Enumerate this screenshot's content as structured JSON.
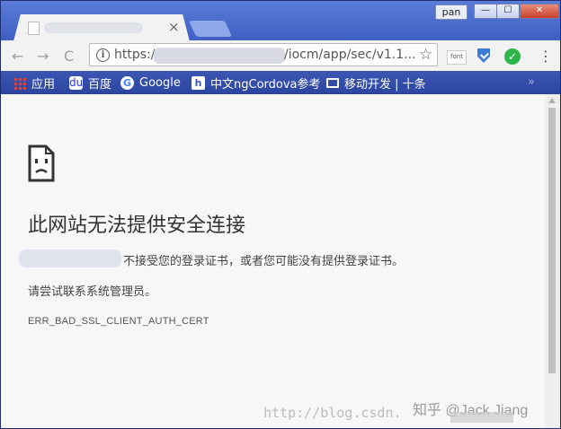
{
  "window": {
    "profile_name": "pan",
    "minimize_glyph": "—",
    "maximize_glyph": "☐",
    "close_glyph": "✕"
  },
  "tab": {
    "close_glyph": "×"
  },
  "toolbar": {
    "back_glyph": "←",
    "forward_glyph": "→",
    "reload_glyph": "C",
    "url_scheme": "https://",
    "url_tail": "/iocm/app/sec/v1.1...",
    "info_glyph": "i",
    "star_glyph": "☆",
    "ext_font_label": "font",
    "ext_check_glyph": "✓",
    "menu_glyph": "⋮"
  },
  "bookmarks": {
    "apps": "应用",
    "baidu": "百度",
    "google": "Google",
    "cordova": "中文ngCordova参考",
    "moving": "移动开发 | 十条",
    "overflow": "»",
    "baidu_glyph": "du",
    "google_glyph": "G",
    "cordova_glyph": "h"
  },
  "error": {
    "title": "此网站无法提供安全连接",
    "description": "不接受您的登录证书，或者您可能没有提供登录证书。",
    "admin_hint": "请尝试联系系统管理员。",
    "code": "ERR_BAD_SSL_CLIENT_AUTH_CERT"
  },
  "watermark": {
    "url": "http://blog.csdn.",
    "zhihu": "知乎 @Jack Jiang"
  },
  "colors": {
    "frame": "#2e4a9e",
    "bookmark_bar": "#2b45a0",
    "page_bg": "#f7f7f7"
  }
}
